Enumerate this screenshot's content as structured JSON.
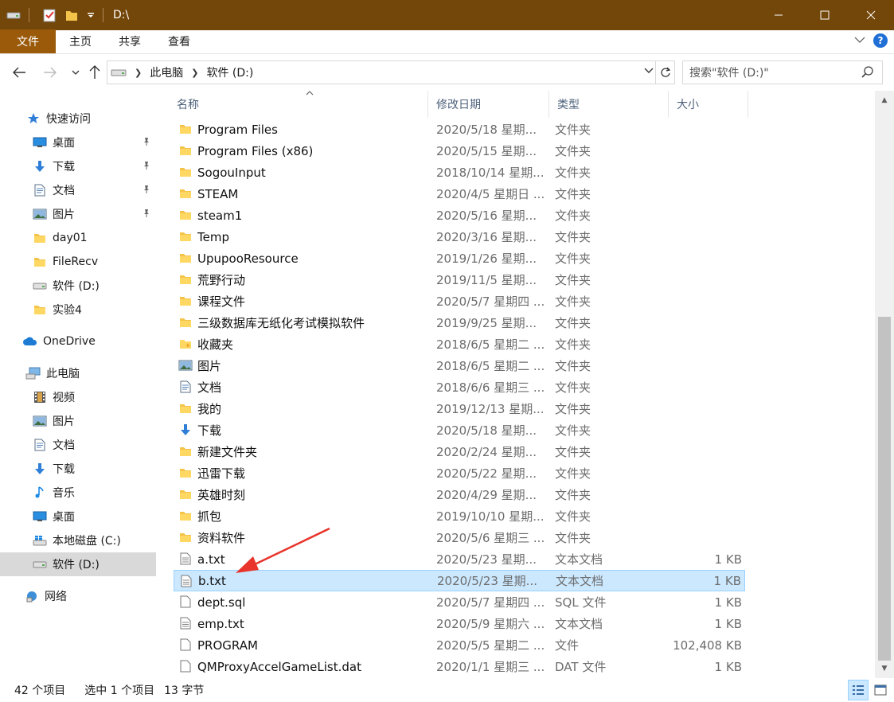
{
  "window": {
    "title": "D:\\",
    "controls": [
      "minimize",
      "maximize",
      "close"
    ]
  },
  "ribbon": {
    "tabs": [
      "文件",
      "主页",
      "共享",
      "查看"
    ],
    "help": "?"
  },
  "address": {
    "segments": [
      "此电脑",
      "软件 (D:)"
    ],
    "search_placeholder": "搜索\"软件 (D:)\""
  },
  "sidebar": {
    "items": [
      {
        "label": "快速访问",
        "icon": "star-icon"
      },
      {
        "label": "桌面",
        "icon": "desktop-icon",
        "pinned": true
      },
      {
        "label": "下载",
        "icon": "download-icon",
        "pinned": true
      },
      {
        "label": "文档",
        "icon": "document-icon",
        "pinned": true
      },
      {
        "label": "图片",
        "icon": "picture-icon",
        "pinned": true
      },
      {
        "label": "day01",
        "icon": "folder-icon"
      },
      {
        "label": "FileRecv",
        "icon": "folder-icon"
      },
      {
        "label": "软件 (D:)",
        "icon": "drive-icon"
      },
      {
        "label": "实验4",
        "icon": "folder-icon"
      },
      {
        "label": "OneDrive",
        "icon": "cloud-icon"
      },
      {
        "label": "此电脑",
        "icon": "computer-icon"
      },
      {
        "label": "视频",
        "icon": "video-icon"
      },
      {
        "label": "图片",
        "icon": "picture-icon"
      },
      {
        "label": "文档",
        "icon": "document-icon"
      },
      {
        "label": "下载",
        "icon": "download-icon"
      },
      {
        "label": "音乐",
        "icon": "music-icon"
      },
      {
        "label": "桌面",
        "icon": "desktop-icon"
      },
      {
        "label": "本地磁盘 (C:)",
        "icon": "windows-drive-icon"
      },
      {
        "label": "软件 (D:)",
        "icon": "drive-icon",
        "selected": true
      },
      {
        "label": "网络",
        "icon": "network-icon"
      }
    ]
  },
  "columns": [
    "名称",
    "修改日期",
    "类型",
    "大小"
  ],
  "files": [
    {
      "name": "Program Files",
      "date": "2020/5/18 星期...",
      "type": "文件夹",
      "size": "",
      "icon": "folder-icon"
    },
    {
      "name": "Program Files (x86)",
      "date": "2020/5/15 星期...",
      "type": "文件夹",
      "size": "",
      "icon": "folder-icon"
    },
    {
      "name": "SogouInput",
      "date": "2018/10/14 星期...",
      "type": "文件夹",
      "size": "",
      "icon": "folder-icon"
    },
    {
      "name": "STEAM",
      "date": "2020/4/5 星期日 ...",
      "type": "文件夹",
      "size": "",
      "icon": "folder-icon"
    },
    {
      "name": "steam1",
      "date": "2020/5/16 星期...",
      "type": "文件夹",
      "size": "",
      "icon": "folder-icon"
    },
    {
      "name": "Temp",
      "date": "2020/3/16 星期...",
      "type": "文件夹",
      "size": "",
      "icon": "folder-icon"
    },
    {
      "name": "UpupooResource",
      "date": "2019/1/26 星期...",
      "type": "文件夹",
      "size": "",
      "icon": "folder-icon"
    },
    {
      "name": "荒野行动",
      "date": "2019/11/5 星期...",
      "type": "文件夹",
      "size": "",
      "icon": "folder-icon"
    },
    {
      "name": "课程文件",
      "date": "2020/5/7 星期四 ...",
      "type": "文件夹",
      "size": "",
      "icon": "folder-icon"
    },
    {
      "name": "三级数据库无纸化考试模拟软件",
      "date": "2019/9/25 星期...",
      "type": "文件夹",
      "size": "",
      "icon": "folder-icon"
    },
    {
      "name": "收藏夹",
      "date": "2018/6/5 星期二 ...",
      "type": "文件夹",
      "size": "",
      "icon": "favorites-folder-icon"
    },
    {
      "name": "图片",
      "date": "2018/6/5 星期二 ...",
      "type": "文件夹",
      "size": "",
      "icon": "picture-icon"
    },
    {
      "name": "文档",
      "date": "2018/6/6 星期三 ...",
      "type": "文件夹",
      "size": "",
      "icon": "document-icon"
    },
    {
      "name": "我的",
      "date": "2019/12/13 星期...",
      "type": "文件夹",
      "size": "",
      "icon": "folder-icon"
    },
    {
      "name": "下载",
      "date": "2020/5/18 星期...",
      "type": "文件夹",
      "size": "",
      "icon": "download-icon"
    },
    {
      "name": "新建文件夹",
      "date": "2020/2/24 星期...",
      "type": "文件夹",
      "size": "",
      "icon": "folder-icon"
    },
    {
      "name": "迅雷下载",
      "date": "2020/5/22 星期...",
      "type": "文件夹",
      "size": "",
      "icon": "folder-icon"
    },
    {
      "name": "英雄时刻",
      "date": "2020/4/29 星期...",
      "type": "文件夹",
      "size": "",
      "icon": "folder-icon"
    },
    {
      "name": "抓包",
      "date": "2019/10/10 星期...",
      "type": "文件夹",
      "size": "",
      "icon": "folder-icon"
    },
    {
      "name": "资料软件",
      "date": "2020/5/6 星期三 ...",
      "type": "文件夹",
      "size": "",
      "icon": "folder-icon"
    },
    {
      "name": "a.txt",
      "date": "2020/5/23 星期...",
      "type": "文本文档",
      "size": "1 KB",
      "icon": "text-file-icon"
    },
    {
      "name": "b.txt",
      "date": "2020/5/23 星期...",
      "type": "文本文档",
      "size": "1 KB",
      "icon": "text-file-icon",
      "selected": true
    },
    {
      "name": "dept.sql",
      "date": "2020/5/7 星期四 ...",
      "type": "SQL 文件",
      "size": "1 KB",
      "icon": "file-icon"
    },
    {
      "name": "emp.txt",
      "date": "2020/5/9 星期六 ...",
      "type": "文本文档",
      "size": "1 KB",
      "icon": "text-file-icon"
    },
    {
      "name": "PROGRAM",
      "date": "2020/5/5 星期二 ...",
      "type": "文件",
      "size": "102,408 KB",
      "icon": "file-icon"
    },
    {
      "name": "QMProxyAccelGameList.dat",
      "date": "2020/1/1 星期三 ...",
      "type": "DAT 文件",
      "size": "1 KB",
      "icon": "file-icon"
    }
  ],
  "status": {
    "count": "42 个项目",
    "selection": "选中 1 个项目",
    "bytes": "13 字节"
  },
  "colors": {
    "titlebar": "#734609",
    "file_tab": "#9a5a0a",
    "selection": "#cce8ff",
    "annotation_arrow": "#e8342b"
  }
}
